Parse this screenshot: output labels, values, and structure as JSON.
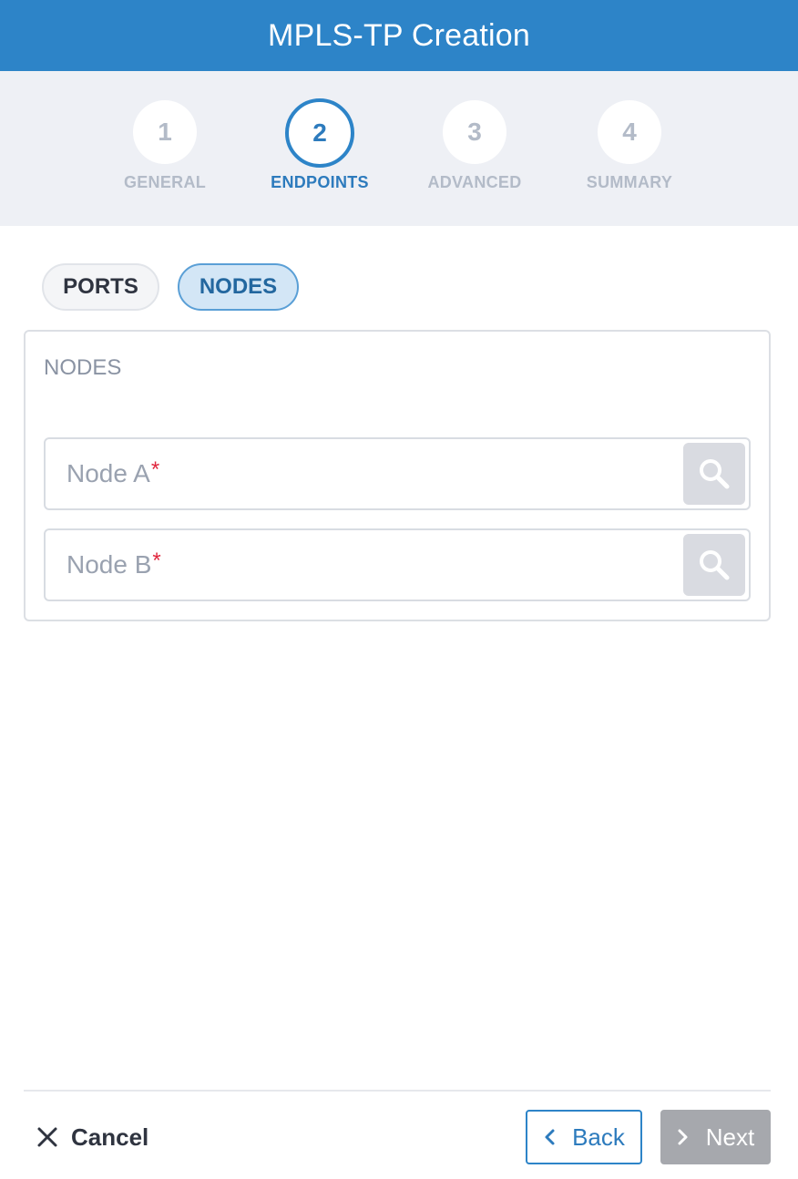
{
  "header": {
    "title": "MPLS-TP Creation"
  },
  "stepper": {
    "steps": [
      {
        "number": "1",
        "label": "GENERAL"
      },
      {
        "number": "2",
        "label": "ENDPOINTS"
      },
      {
        "number": "3",
        "label": "ADVANCED"
      },
      {
        "number": "4",
        "label": "SUMMARY"
      }
    ],
    "active_step": 2
  },
  "toggles": {
    "ports": "PORTS",
    "nodes": "NODES",
    "selected": "NODES"
  },
  "panel": {
    "title": "NODES",
    "fields": [
      {
        "label": "Node A",
        "required_mark": "*",
        "value": ""
      },
      {
        "label": "Node B",
        "required_mark": "*",
        "value": ""
      }
    ]
  },
  "footer": {
    "cancel": "Cancel",
    "back": "Back",
    "next": "Next"
  },
  "colors": {
    "accent": "#2d84c8",
    "step_inactive": "#b3bbc8",
    "required": "#e0263d",
    "next_disabled": "#a6a8ad"
  },
  "icons": {
    "search": "search-icon",
    "cancel": "close-icon",
    "back": "chevron-left-icon",
    "next": "chevron-right-icon"
  }
}
